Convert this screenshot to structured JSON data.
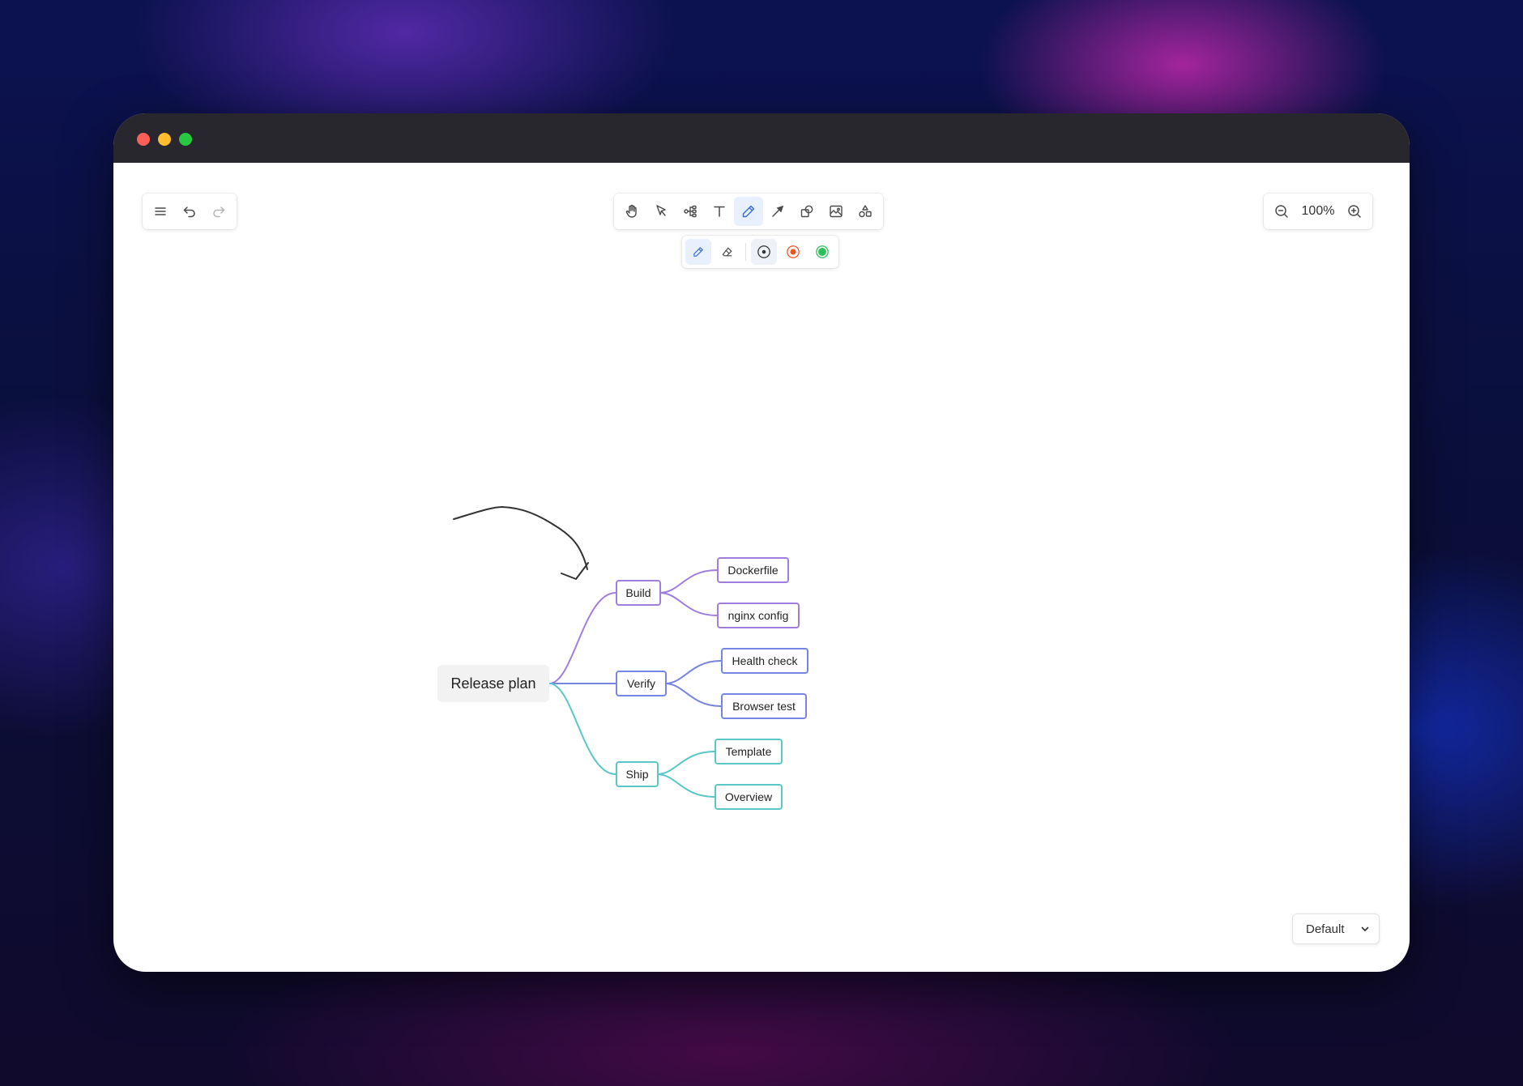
{
  "toolbar_left": {
    "items": [
      {
        "icon": "menu-icon"
      },
      {
        "icon": "undo-icon"
      },
      {
        "icon": "redo-icon"
      }
    ]
  },
  "toolbar_main": {
    "items": [
      {
        "icon": "hand-icon"
      },
      {
        "icon": "pointer-icon"
      },
      {
        "icon": "mindmap-icon"
      },
      {
        "icon": "text-icon"
      },
      {
        "icon": "pen-icon",
        "active": true
      },
      {
        "icon": "arrow-icon"
      },
      {
        "icon": "shapes-icon"
      },
      {
        "icon": "image-icon"
      },
      {
        "icon": "extra-shapes-icon"
      }
    ]
  },
  "pen_options": {
    "tools": [
      {
        "icon": "pen-icon",
        "active": true
      },
      {
        "icon": "eraser-icon"
      }
    ],
    "colors": [
      "#333333",
      "#f0541e",
      "#2dbf5a"
    ],
    "selected_color": "#333333"
  },
  "zoom": {
    "level": "100%"
  },
  "mindmap": {
    "root": "Release plan",
    "branches": [
      {
        "label": "Build",
        "color": "#a07ee0",
        "children": [
          "Dockerfile",
          "nginx config"
        ]
      },
      {
        "label": "Verify",
        "color": "#7684e2",
        "children": [
          "Health check",
          "Browser test"
        ]
      },
      {
        "label": "Ship",
        "color": "#5ac7c7",
        "children": [
          "Template",
          "Overview"
        ]
      }
    ]
  },
  "theme_select": {
    "value": "Default"
  }
}
